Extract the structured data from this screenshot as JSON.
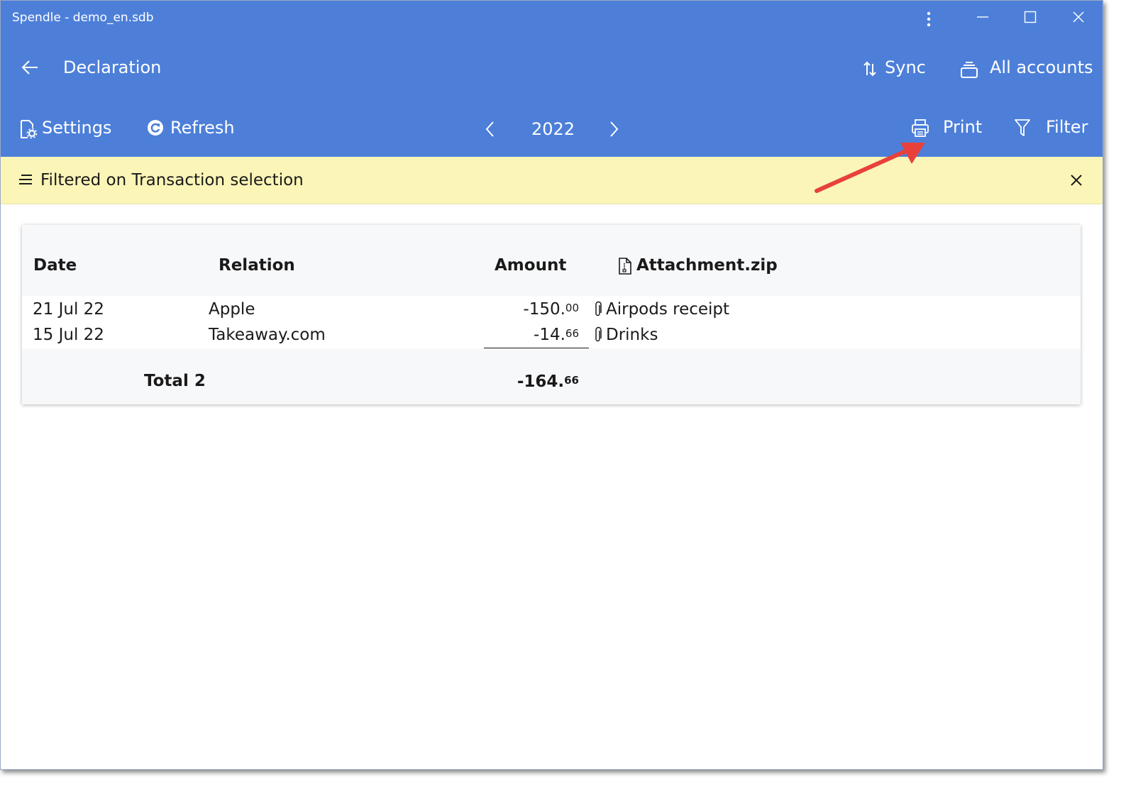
{
  "window": {
    "title": "Spendle - demo_en.sdb"
  },
  "nav": {
    "page_title": "Declaration",
    "sync_label": "Sync",
    "accounts_label": "All accounts"
  },
  "toolbar": {
    "settings_label": "Settings",
    "refresh_label": "Refresh",
    "year": "2022",
    "print_label": "Print",
    "filter_label": "Filter"
  },
  "filter_banner": {
    "text": "Filtered on Transaction selection"
  },
  "table": {
    "headers": {
      "date": "Date",
      "relation": "Relation",
      "amount": "Amount",
      "attachment": "Attachment.zip"
    },
    "rows": [
      {
        "date": "21 Jul 22",
        "relation": "Apple",
        "amount_main": "-150.",
        "amount_cents": "00",
        "attachment": "Airpods receipt"
      },
      {
        "date": "15 Jul 22",
        "relation": "Takeaway.com",
        "amount_main": "-14.",
        "amount_cents": "66",
        "attachment": "Drinks"
      }
    ],
    "total": {
      "label": "Total 2",
      "amount_main": "-164.",
      "amount_cents": "66"
    }
  },
  "colors": {
    "appbar": "#4d7fd9",
    "banner": "#fbf5b7",
    "annotation_arrow": "#e8413c"
  }
}
